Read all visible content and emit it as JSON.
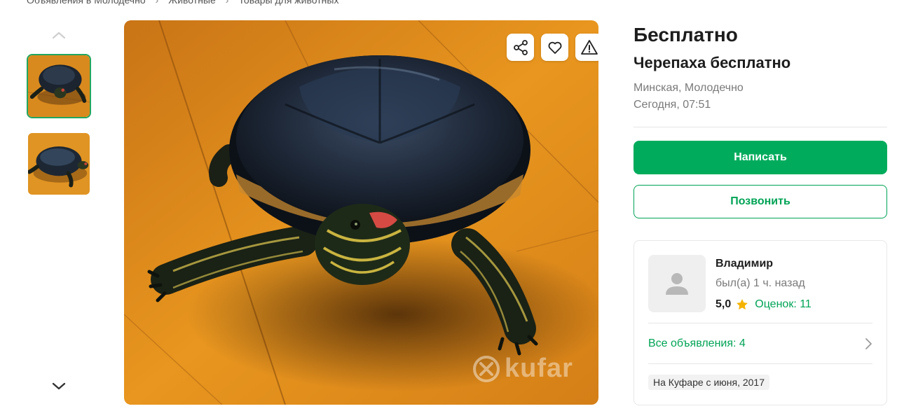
{
  "breadcrumb": {
    "items": [
      "Объявления в Молодечно",
      "Животные",
      "Товары для животных"
    ],
    "separator": "›"
  },
  "gallery": {
    "thumbnails": [
      "turtle-photo-1",
      "turtle-photo-2"
    ],
    "selected_index": 0,
    "watermark": "kufar"
  },
  "listing": {
    "price": "Бесплатно",
    "title": "Черепаха бесплатно",
    "location": "Минская, Молодечно",
    "date": "Сегодня, 07:51"
  },
  "actions": {
    "write_label": "Написать",
    "call_label": "Позвонить"
  },
  "seller": {
    "name": "Владимир",
    "last_seen": "был(а) 1 ч. назад",
    "rating": "5,0",
    "reviews": "Оценок: 11",
    "all_ads": "Все объявления: 4",
    "since": "На Куфаре с июня, 2017"
  },
  "colors": {
    "accent": "#00ac5c",
    "accent_text": "#00a356",
    "star": "#f5b301"
  },
  "icons": [
    "chevron-up-icon",
    "chevron-down-icon",
    "share-icon",
    "heart-icon",
    "warning-icon",
    "user-icon",
    "star-icon",
    "chevron-right-icon"
  ]
}
